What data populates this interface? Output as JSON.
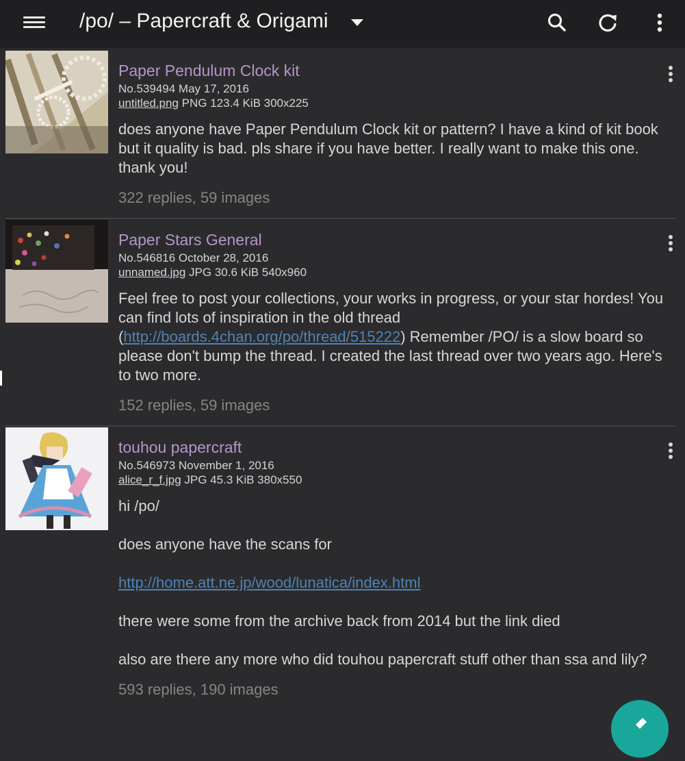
{
  "header": {
    "board_title": "/po/ – Papercraft & Origami"
  },
  "threads": [
    {
      "subject": "Paper Pendulum Clock kit",
      "meta": "No.539494 May 17, 2016",
      "filename": "untitled.png",
      "fileinfo": " PNG 123.4 KiB 300x225",
      "body": "does anyone have Paper Pendulum Clock kit or pattern? I have a kind of kit book but it quality is bad. pls share if you have better. I really want to make this one. thank you!",
      "stats": "322 replies, 59 images"
    },
    {
      "subject": "Paper Stars General",
      "meta": "No.546816 October 28, 2016",
      "filename": "unnamed.jpg",
      "fileinfo": " JPG 30.6 KiB 540x960",
      "body_pre": "Feel free to post your collections, your works in progress, or your star hordes! You can find lots of inspiration in the old thread (",
      "body_link": "http://boards.4chan.org/po/thread/515222",
      "body_post": ") Remember /PO/ is a slow board so please don't bump the thread. I created the last thread over two years ago. Here's to two more.",
      "stats": "152 replies, 59 images"
    },
    {
      "subject": "touhou papercraft",
      "meta": "No.546973 November 1, 2016",
      "filename": "alice_r_f.jpg",
      "fileinfo": " JPG 45.3 KiB 380x550",
      "p1": "hi /po/",
      "p2": "does anyone have the scans for",
      "p3_link": "http://home.att.ne.jp/wood/lunatica/index.html",
      "p4": "there were some from the archive back from 2014 but the link died",
      "p5": "also are there any more who did touhou papercraft stuff other than ssa and lily?",
      "stats": "593 replies, 190 images"
    }
  ],
  "icons": {
    "menu": "hamburger-menu-icon",
    "dropdown": "caret-down-icon",
    "search": "search-icon",
    "refresh": "refresh-icon",
    "overflow": "more-vert-icon",
    "fab": "pencil-icon"
  },
  "colors": {
    "background": "#2b2b2e",
    "toolbar": "#1f1f21",
    "subject": "#b795c9",
    "link": "#4f83b4",
    "fab": "#1aa79b"
  }
}
